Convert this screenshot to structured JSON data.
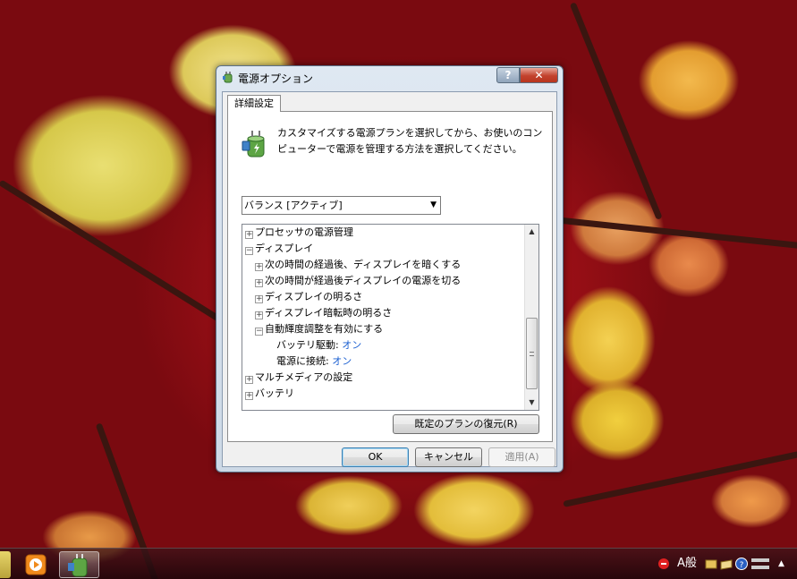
{
  "window": {
    "title": "電源オプション",
    "help_label": "?",
    "close_label": "✕",
    "tab_label": "詳細設定",
    "description": "カスタマイズする電源プランを選択してから、お使いのコンピューターで電源を管理する方法を選択してください。",
    "plan_select": {
      "value": "バランス [アクティブ]",
      "arrow": "▼"
    },
    "tree": {
      "processor": "プロセッサの電源管理",
      "display": "ディスプレイ",
      "dim_after": "次の時間の経過後、ディスプレイを暗くする",
      "off_after": "次の時間が経過後ディスプレイの電源を切る",
      "brightness": "ディスプレイの明るさ",
      "dimmed_brightness": "ディスプレイ暗転時の明るさ",
      "adaptive": "自動輝度調整を有効にする",
      "battery_label": "バッテリ駆動:",
      "battery_value": "オン",
      "plugged_label": "電源に接続:",
      "plugged_value": "オン",
      "multimedia": "マルチメディアの設定",
      "battery": "バッテリ"
    },
    "buttons": {
      "restore": "既定のプランの復元(R)",
      "ok": "OK",
      "cancel": "キャンセル",
      "apply": "適用(A)"
    }
  },
  "taskbar": {
    "ime_label": "A般",
    "tray_up": "▲"
  },
  "icons": {
    "title_icon": "power-options-icon",
    "description_icon": "power-plan-icon",
    "media_player": "media-player-icon",
    "active_app": "power-options-icon",
    "tray_flag": "action-center-flag-icon",
    "tray_help": "help-icon"
  },
  "colors": {
    "link_value": "#1a5fd1",
    "close_button": "#c2422d"
  }
}
